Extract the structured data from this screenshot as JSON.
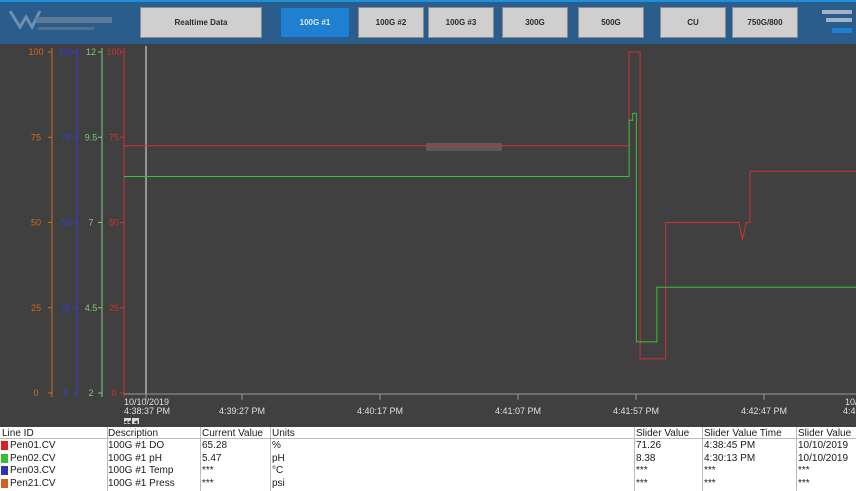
{
  "nav": {
    "buttons": [
      {
        "label": "Realtime Data",
        "active": false
      },
      {
        "label": "100G #1",
        "active": true
      },
      {
        "label": "100G #2",
        "active": false
      },
      {
        "label": "100G #3",
        "active": false
      },
      {
        "label": "300G",
        "active": false
      },
      {
        "label": "500G",
        "active": false
      },
      {
        "label": "CU",
        "active": false
      },
      {
        "label": "750G/800",
        "active": false
      }
    ]
  },
  "chart": {
    "axes": [
      {
        "color": "#d2691e",
        "ticks": [
          "100",
          "75",
          "50",
          "25",
          "0"
        ]
      },
      {
        "color": "#3b3bd0",
        "ticks": [
          "100",
          "75",
          "50",
          "25",
          "0"
        ]
      },
      {
        "color": "#7ec97e",
        "ticks": [
          "12",
          "9.5",
          "7",
          "4.5",
          "2"
        ]
      },
      {
        "color": "#d03030",
        "ticks": [
          "100",
          "75",
          "50",
          "25",
          "0"
        ]
      }
    ],
    "x_first_date": "10/10/2019",
    "x_ticks": [
      "4:38:37 PM",
      "4:39:27 PM",
      "4:40:17 PM",
      "4:41:07 PM",
      "4:41:57 PM",
      "4:42:47 PM"
    ],
    "x_last_date_partial": "10/",
    "x_last_time_partial": "4:4",
    "nav_arrows": [
      "◀◀",
      "◀"
    ]
  },
  "chart_data": {
    "type": "line",
    "x_range": [
      "4:38:37 PM",
      "4:43:37 PM"
    ],
    "series": [
      {
        "color": "#d03030",
        "points": [
          [
            0.0,
            72.5
          ],
          [
            0.69,
            72.5
          ],
          [
            0.69,
            100
          ],
          [
            0.705,
            100
          ],
          [
            0.705,
            10
          ],
          [
            0.74,
            10
          ],
          [
            0.74,
            50
          ],
          [
            0.84,
            50
          ],
          [
            0.845,
            45
          ],
          [
            0.85,
            50
          ],
          [
            0.855,
            50
          ],
          [
            0.855,
            65
          ],
          [
            1.0,
            65
          ]
        ]
      },
      {
        "color": "#3cbf3c",
        "points": [
          [
            0.0,
            63.5
          ],
          [
            0.69,
            63.5
          ],
          [
            0.69,
            80
          ],
          [
            0.695,
            80
          ],
          [
            0.695,
            82
          ],
          [
            0.7,
            82
          ],
          [
            0.7,
            15
          ],
          [
            0.728,
            15
          ],
          [
            0.728,
            31
          ],
          [
            1.0,
            31
          ]
        ]
      }
    ]
  },
  "table": {
    "headers": [
      "Line ID",
      "Description",
      "Current Value",
      "Units",
      "Slider Value",
      "Slider Value Time",
      "Slider Value"
    ],
    "rows": [
      {
        "color": "#e02020",
        "id": "Pen01.CV",
        "desc": "100G #1 DO",
        "value": "65.28",
        "units": "%",
        "slider": "71.26",
        "slider_time": "4:38:45 PM",
        "slider_date": "10/10/2019"
      },
      {
        "color": "#30c030",
        "id": "Pen02.CV",
        "desc": "100G #1 pH",
        "value": "5.47",
        "units": "pH",
        "slider": "8.38",
        "slider_time": "4:30:13 PM",
        "slider_date": "10/10/2019"
      },
      {
        "color": "#3030c0",
        "id": "Pen03.CV",
        "desc": "100G #1 Temp",
        "value": "***",
        "units": "°C",
        "slider": "***",
        "slider_time": "***",
        "slider_date": "***"
      },
      {
        "color": "#d06020",
        "id": "Pen21.CV",
        "desc": "100G #1 Press",
        "value": "***",
        "units": "psi",
        "slider": "***",
        "slider_time": "***",
        "slider_date": "***"
      }
    ]
  }
}
